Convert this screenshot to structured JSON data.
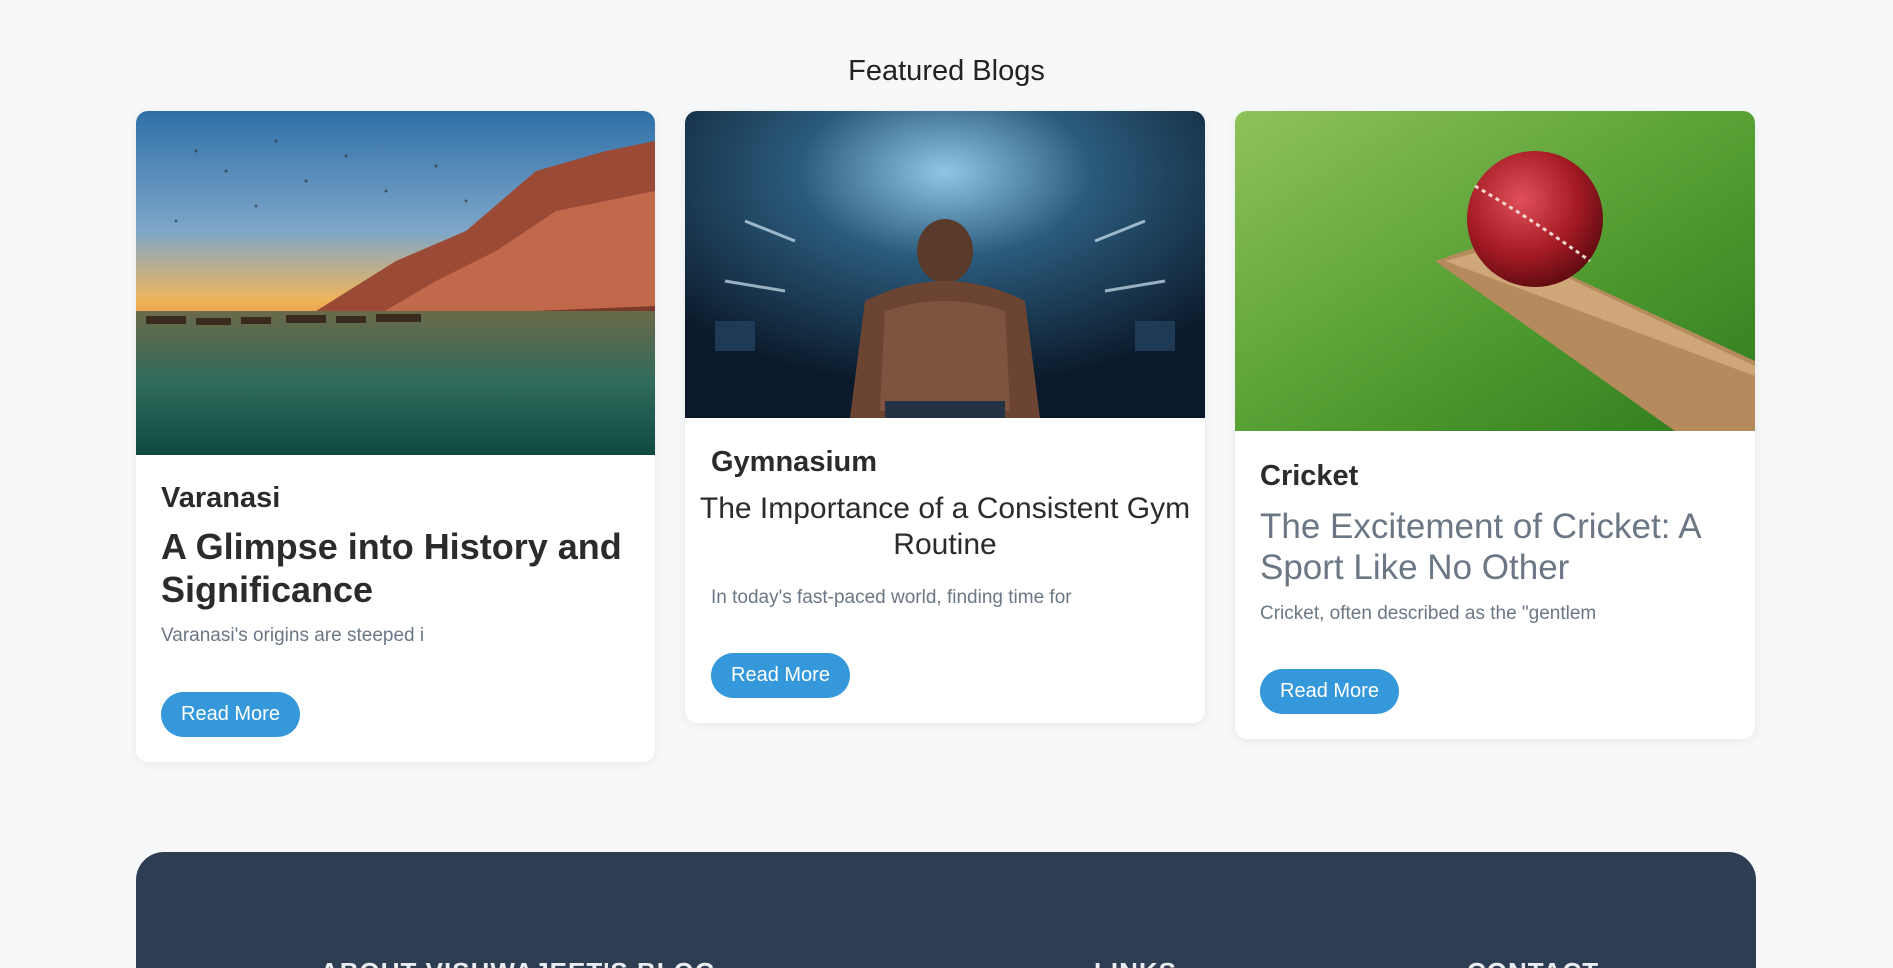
{
  "section_title": "Featured Blogs",
  "cards": [
    {
      "category": "Varanasi",
      "title": "A Glimpse into History and Significance",
      "excerpt": "Varanasi's origins are steeped i",
      "button": "Read More",
      "image": "varanasi-ghats-sunset-image"
    },
    {
      "category": "Gymnasium",
      "title": "The Importance of a Consistent Gym Routine",
      "excerpt": "In today's fast-paced world, finding time for",
      "button": "Read More",
      "image": "gym-athlete-back-image"
    },
    {
      "category": "Cricket",
      "title": "The Excitement of Cricket: A Sport Like No Other",
      "excerpt": "Cricket, often described as the \"gentlem",
      "button": "Read More",
      "image": "cricket-ball-bat-image"
    }
  ],
  "footer": {
    "about_heading": "ABOUT VISHWAJEET'S BLOG",
    "links_heading": "LINKS",
    "contact_heading": "CONTACT"
  },
  "colors": {
    "background": "#f7f8fa",
    "accent": "#3498db",
    "footer_bg": "#2e3e52",
    "muted_text": "#6b7785"
  }
}
